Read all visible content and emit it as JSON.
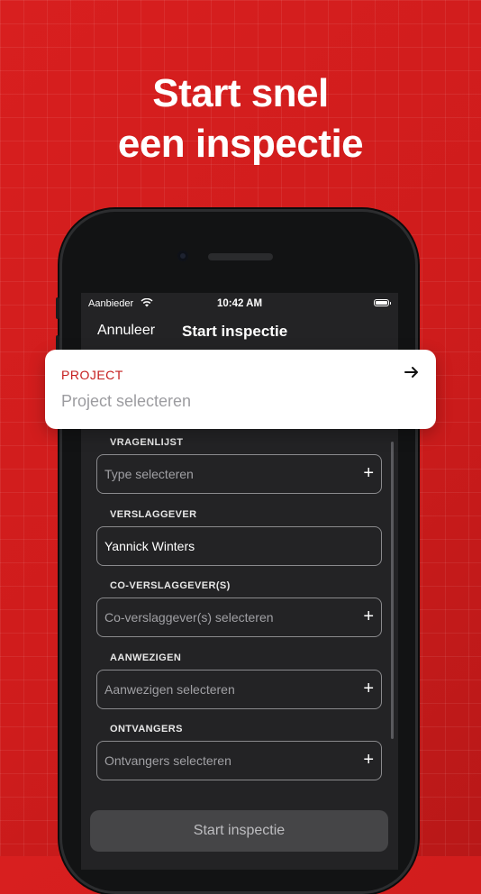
{
  "headline": {
    "line1": "Start snel",
    "line2": "een inspectie"
  },
  "statusbar": {
    "carrier": "Aanbieder",
    "time": "10:42 AM"
  },
  "navbar": {
    "cancel": "Annuleer",
    "title": "Start inspectie"
  },
  "project": {
    "label": "PROJECT",
    "placeholder": "Project selecteren"
  },
  "fields": [
    {
      "label": "VRAGENLIJST",
      "value": "Type selecteren",
      "filled": false,
      "icon": "plus-icon"
    },
    {
      "label": "VERSLAGGEVER",
      "value": "Yannick Winters",
      "filled": true,
      "icon": ""
    },
    {
      "label": "CO-VERSLAGGEVER(S)",
      "value": "Co-verslaggever(s) selecteren",
      "filled": false,
      "icon": "plus-icon"
    },
    {
      "label": "AANWEZIGEN",
      "value": "Aanwezigen selecteren",
      "filled": false,
      "icon": "plus-icon"
    },
    {
      "label": "ONTVANGERS",
      "value": "Ontvangers selecteren",
      "filled": false,
      "icon": "plus-icon"
    }
  ],
  "start_button": "Start inspectie",
  "colors": {
    "brand_red": "#d81f1f",
    "project_label": "#c51d1d",
    "screen_bg": "#232325"
  }
}
